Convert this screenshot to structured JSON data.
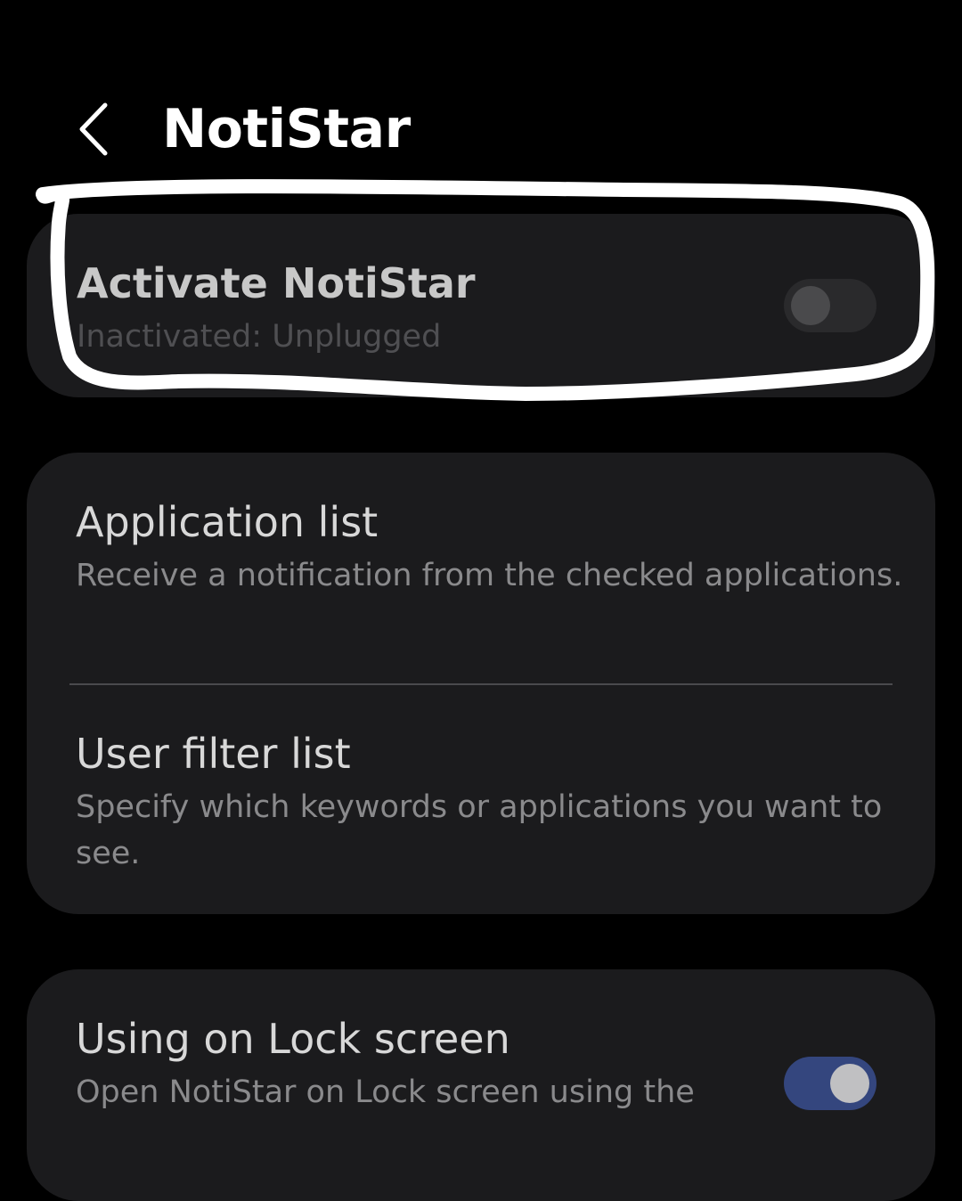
{
  "header": {
    "back_icon": "chevron-left-icon",
    "title": "NotiStar"
  },
  "activate": {
    "title": "Activate NotiStar",
    "status": "Inactivated: Unplugged",
    "toggle_on": false
  },
  "lists": {
    "items": [
      {
        "title": "Application list",
        "description": "Receive a notification from the checked applications."
      },
      {
        "title": "User filter list",
        "description": "Specify which keywords or applications you want to see."
      }
    ]
  },
  "lock_screen": {
    "title": "Using on Lock screen",
    "description": "Open NotiStar on Lock screen using the",
    "toggle_on": true
  },
  "colors": {
    "background": "#000000",
    "card": "#1b1b1d",
    "toggle_on_track": "#34467e",
    "annotation_stroke": "#ffffff"
  }
}
